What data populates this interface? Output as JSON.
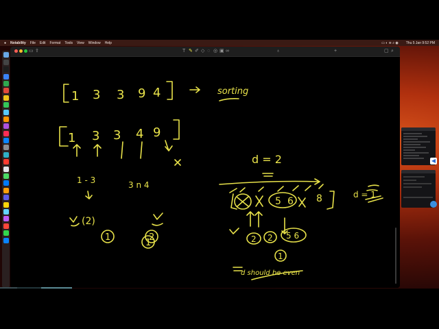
{
  "menubar": {
    "app_name": "Notability",
    "menus": [
      "File",
      "Edit",
      "Format",
      "Tools",
      "View",
      "Window",
      "Help"
    ],
    "clock": "Thu 5 Jan  9:52 PM"
  },
  "colors": {
    "ink": "#e8e24a",
    "canvas": "#000000",
    "wallpaper_accent": "#d8541c"
  },
  "toolbar": {
    "tools": [
      "text-tool",
      "pen-tool",
      "highlighter-tool",
      "eraser-tool",
      "lasso-tool",
      "shapes-tool",
      "image-tool",
      "link-tool"
    ]
  },
  "notes": {
    "array_top": [
      "1",
      "3",
      "3",
      "9",
      "4"
    ],
    "arrow_label": "sorting",
    "array_sorted": [
      "1",
      "3",
      "3",
      "4",
      "9"
    ],
    "pair_left": "1 - 3",
    "pair_right": "3 n 4",
    "left_count": "(2)",
    "right_count": "1",
    "left_circled": "1",
    "right_circled": "2",
    "d_value": "d = 2",
    "d_right": "d = 1",
    "row_values": [
      "5",
      "6",
      "8"
    ],
    "circled_row": [
      "2",
      "2",
      "5 6"
    ],
    "circled_one": "1",
    "bottom_text": "d should be even"
  }
}
